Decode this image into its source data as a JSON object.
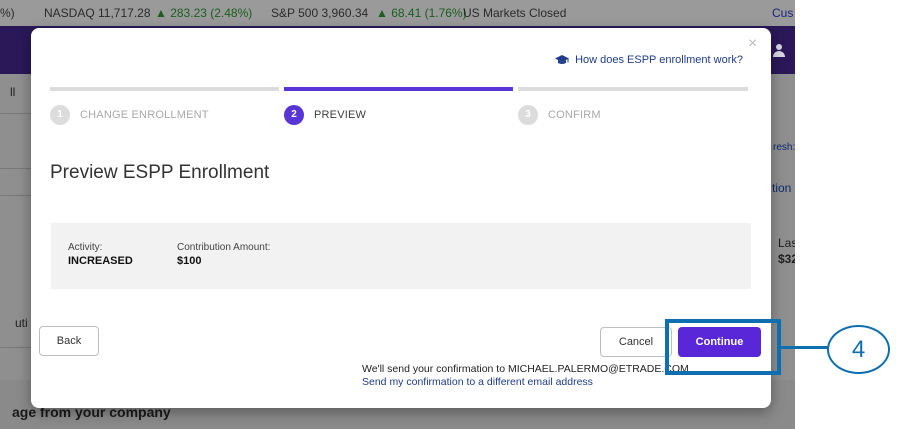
{
  "ticker": {
    "percent_frag": "%)",
    "nasdaq": "NASDAQ 11,717.28",
    "nasdaq_change": "▲ 283.23 (2.48%)",
    "sp500": "S&P 500 3,960.34",
    "sp500_change": "▲ 68.41 (1.76%)",
    "market_status": "US Markets Closed",
    "right_link": "Cus"
  },
  "background": {
    "left_frag_top": "ll",
    "right_frag_refresh": "resh:",
    "right_frag_action": "tion I",
    "right_frag_last": "Las",
    "right_frag_price": "$32",
    "left_frag_mid": "uti",
    "bottom_text": "age from your company"
  },
  "modal": {
    "help_link": "How does ESPP enrollment work?",
    "close": "×",
    "steps": [
      {
        "number": "1",
        "label": "CHANGE ENROLLMENT"
      },
      {
        "number": "2",
        "label": "PREVIEW"
      },
      {
        "number": "3",
        "label": "CONFIRM"
      }
    ],
    "title": "Preview ESPP Enrollment",
    "summary": {
      "activity_label": "Activity:",
      "activity_value": "INCREASED",
      "amount_label": "Contribution Amount:",
      "amount_value": "$100"
    },
    "buttons": {
      "back": "Back",
      "cancel": "Cancel",
      "continue": "Continue"
    },
    "confirmation_text": "We'll send your confirmation to MICHAEL.PALERMO@ETRADE.COM",
    "confirmation_link": "Send my confirmation to a different email address"
  },
  "annotation": {
    "step_number": "4"
  },
  "colors": {
    "accent": "#5a35d6",
    "callout": "#0e6fb0",
    "link": "#1f3c88"
  }
}
